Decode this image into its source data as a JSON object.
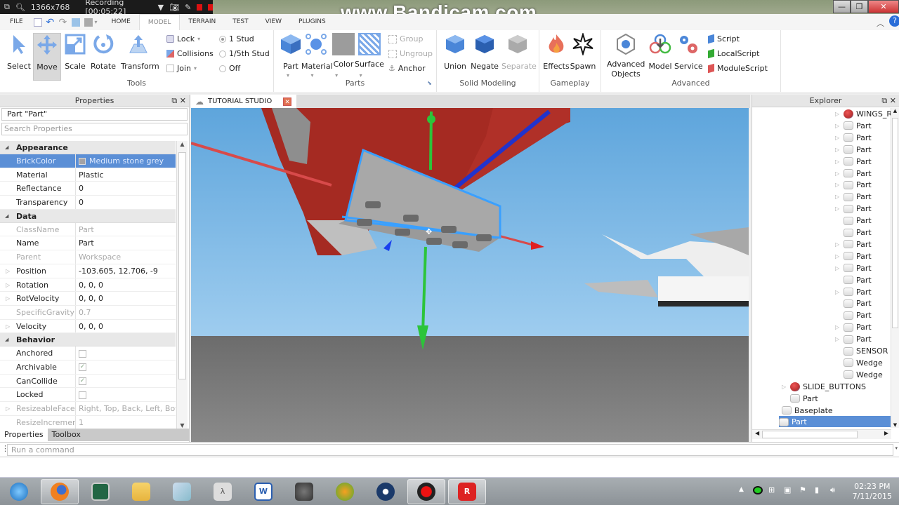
{
  "recorder": {
    "resolution": "1366x768",
    "status": "Recording [00:05:22]",
    "watermark": "www.Bandicam.com"
  },
  "window_controls": {
    "minimize": "—",
    "restore": "❐",
    "close": "✕"
  },
  "menu": {
    "file": "FILE",
    "tabs": [
      "HOME",
      "MODEL",
      "TERRAIN",
      "TEST",
      "VIEW",
      "PLUGINS"
    ],
    "active_tab": "MODEL"
  },
  "ribbon": {
    "tools": {
      "label": "Tools",
      "buttons": [
        "Select",
        "Move",
        "Scale",
        "Rotate",
        "Transform"
      ],
      "selected": "Move",
      "lock": "Lock",
      "collisions": "Collisions",
      "join": "Join",
      "snap_options": [
        "1 Stud",
        "1/5th Stud",
        "Off"
      ],
      "snap_selected": "1 Stud"
    },
    "parts": {
      "label": "Parts",
      "buttons": [
        "Part",
        "Material",
        "Color",
        "Surface"
      ],
      "group": "Group",
      "ungroup": "Ungroup",
      "anchor": "Anchor"
    },
    "solid_modeling": {
      "label": "Solid Modeling",
      "buttons": [
        "Union",
        "Negate",
        "Separate"
      ]
    },
    "gameplay": {
      "label": "Gameplay",
      "buttons": [
        "Effects",
        "Spawn"
      ]
    },
    "advanced": {
      "label": "Advanced",
      "advanced_objects_1": "Advanced",
      "advanced_objects_2": "Objects",
      "model": "Model",
      "service": "Service",
      "scripts": [
        "Script",
        "LocalScript",
        "ModuleScript"
      ]
    }
  },
  "properties": {
    "title": "Properties",
    "selection": "Part \"Part\"",
    "search_placeholder": "Search Properties",
    "categories": {
      "appearance": "Appearance",
      "data": "Data",
      "behavior": "Behavior"
    },
    "appearance": [
      {
        "k": "BrickColor",
        "v": "Medium stone grey"
      },
      {
        "k": "Material",
        "v": "Plastic"
      },
      {
        "k": "Reflectance",
        "v": "0"
      },
      {
        "k": "Transparency",
        "v": "0"
      }
    ],
    "data": [
      {
        "k": "ClassName",
        "v": "Part"
      },
      {
        "k": "Name",
        "v": "Part"
      },
      {
        "k": "Parent",
        "v": "Workspace"
      },
      {
        "k": "Position",
        "v": "-103.605, 12.706, -9"
      },
      {
        "k": "Rotation",
        "v": "0, 0, 0"
      },
      {
        "k": "RotVelocity",
        "v": "0, 0, 0"
      },
      {
        "k": "SpecificGravity",
        "v": "0.7"
      },
      {
        "k": "Velocity",
        "v": "0, 0, 0"
      }
    ],
    "behavior": [
      {
        "k": "Anchored",
        "checked": false
      },
      {
        "k": "Archivable",
        "checked": true
      },
      {
        "k": "CanCollide",
        "checked": true
      },
      {
        "k": "Locked",
        "checked": false
      },
      {
        "k": "ResizeableFaces",
        "v": "Right, Top, Back, Left, Bot..."
      },
      {
        "k": "ResizeIncrement",
        "v": "1"
      }
    ],
    "tabs": [
      "Properties",
      "Toolbox"
    ]
  },
  "viewport": {
    "tab_title": "TUTORIAL STUDIO"
  },
  "explorer": {
    "title": "Explorer",
    "items": [
      {
        "label": "WINGS_R",
        "type": "model",
        "expand": true,
        "indent": 2
      },
      {
        "label": "Part",
        "type": "part",
        "expand": true,
        "indent": 2
      },
      {
        "label": "Part",
        "type": "part",
        "expand": true,
        "indent": 2
      },
      {
        "label": "Part",
        "type": "part",
        "expand": true,
        "indent": 2
      },
      {
        "label": "Part",
        "type": "part",
        "expand": true,
        "indent": 2
      },
      {
        "label": "Part",
        "type": "part",
        "expand": true,
        "indent": 2
      },
      {
        "label": "Part",
        "type": "part",
        "expand": true,
        "indent": 2
      },
      {
        "label": "Part",
        "type": "part",
        "expand": true,
        "indent": 2
      },
      {
        "label": "Part",
        "type": "part",
        "expand": true,
        "indent": 2
      },
      {
        "label": "Part",
        "type": "part",
        "expand": false,
        "indent": 2
      },
      {
        "label": "Part",
        "type": "part",
        "expand": false,
        "indent": 2
      },
      {
        "label": "Part",
        "type": "part",
        "expand": true,
        "indent": 2
      },
      {
        "label": "Part",
        "type": "part",
        "expand": true,
        "indent": 2
      },
      {
        "label": "Part",
        "type": "part",
        "expand": true,
        "indent": 2
      },
      {
        "label": "Part",
        "type": "part",
        "expand": false,
        "indent": 2
      },
      {
        "label": "Part",
        "type": "part",
        "expand": true,
        "indent": 2
      },
      {
        "label": "Part",
        "type": "part",
        "expand": false,
        "indent": 2
      },
      {
        "label": "Part",
        "type": "part",
        "expand": false,
        "indent": 2
      },
      {
        "label": "Part",
        "type": "part",
        "expand": true,
        "indent": 2
      },
      {
        "label": "Part",
        "type": "part",
        "expand": true,
        "indent": 2
      },
      {
        "label": "SENSOR",
        "type": "part",
        "expand": false,
        "indent": 2
      },
      {
        "label": "Wedge",
        "type": "part",
        "expand": false,
        "indent": 2
      },
      {
        "label": "Wedge",
        "type": "part",
        "expand": false,
        "indent": 2
      },
      {
        "label": "SLIDE_BUTTONS",
        "type": "model",
        "expand": true,
        "indent": 1
      },
      {
        "label": "Part",
        "type": "part",
        "expand": false,
        "indent": 1
      },
      {
        "label": "Baseplate",
        "type": "part",
        "expand": false,
        "indent": 0
      },
      {
        "label": "Part",
        "type": "part",
        "expand": false,
        "indent": 0,
        "selected": true
      }
    ]
  },
  "command_bar": {
    "placeholder": "Run a command"
  },
  "taskbar": {
    "apps": [
      "Start",
      "Firefox",
      "Task Manager",
      "File Explorer",
      "Notepad",
      "Equation App",
      "Word",
      "GIMP",
      "FL Studio",
      "Steam",
      "Bandicam",
      "Roblox Studio"
    ],
    "open_apps": [
      "Firefox",
      "Bandicam",
      "Roblox Studio"
    ],
    "time": "02:23 PM",
    "date": "7/11/2015"
  },
  "colors": {
    "selection_blue": "#5b8fd6",
    "axis_x": "#d83a3a",
    "axis_y": "#2cc43a",
    "axis_z": "#2233dd",
    "selection_box": "#3aa0ff"
  }
}
